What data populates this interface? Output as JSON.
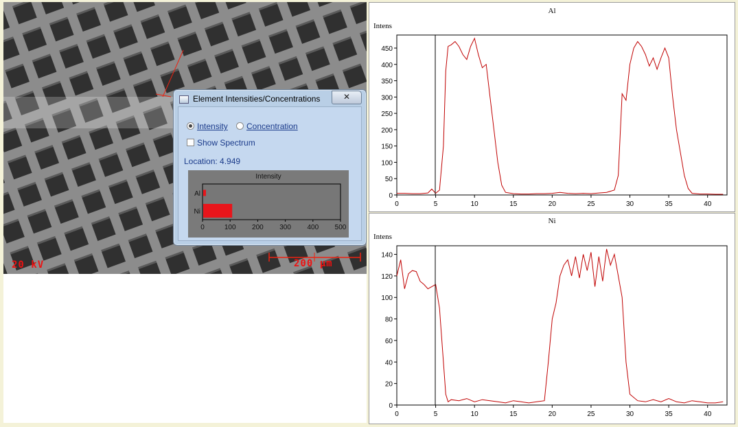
{
  "micrograph": {
    "kv_label": "20 kV",
    "scale_label": "200 µm"
  },
  "dialog": {
    "title": "Element Intensities/Concentrations",
    "close_glyph": "✕",
    "radio_intensity": "Intensity",
    "radio_concentration": "Concentration",
    "selected_mode": "Intensity",
    "show_spectrum_label": "Show Spectrum",
    "show_spectrum_checked": false,
    "location_text": "Location: 4.949",
    "bar_chart": {
      "title": "Intensity",
      "categories": [
        "Al",
        "Ni"
      ],
      "values": [
        10,
        105
      ],
      "xticks": [
        "0",
        "100",
        "200",
        "300",
        "400",
        "500"
      ],
      "xlim": [
        0,
        500
      ],
      "bar_color": "#e8151b"
    }
  },
  "chart_data": [
    {
      "type": "line",
      "title": "Al",
      "ylabel": "Intens",
      "xlim": [
        0,
        42.5
      ],
      "ylim": [
        0,
        490
      ],
      "xticks": [
        0,
        5,
        10,
        15,
        20,
        25,
        30,
        35,
        40
      ],
      "yticks": [
        0,
        50,
        100,
        150,
        200,
        250,
        300,
        350,
        400,
        450
      ],
      "marker_x": 4.949,
      "color": "#c00000",
      "x": [
        0,
        1,
        2,
        3,
        4,
        4.5,
        5,
        5.5,
        6,
        6.3,
        6.6,
        7,
        7.5,
        8,
        8.5,
        9,
        9.5,
        10,
        10.5,
        11,
        11.5,
        12,
        12.5,
        13,
        13.5,
        14,
        15,
        16,
        17,
        18,
        19,
        20,
        21,
        22,
        23,
        24,
        25,
        26,
        27,
        28,
        28.5,
        29,
        29.5,
        30,
        30.5,
        31,
        31.5,
        32,
        32.5,
        33,
        33.5,
        34,
        34.5,
        35,
        35.5,
        36,
        36.5,
        37,
        37.5,
        38,
        39,
        40,
        41,
        42
      ],
      "y": [
        5,
        5,
        4,
        4,
        6,
        18,
        5,
        15,
        150,
        380,
        455,
        460,
        470,
        455,
        430,
        415,
        455,
        480,
        430,
        390,
        400,
        300,
        200,
        100,
        30,
        8,
        4,
        3,
        3,
        4,
        4,
        5,
        8,
        5,
        4,
        5,
        4,
        6,
        8,
        15,
        60,
        310,
        290,
        400,
        450,
        470,
        455,
        430,
        395,
        420,
        385,
        420,
        450,
        420,
        300,
        200,
        130,
        60,
        20,
        5,
        3,
        3,
        2,
        2
      ]
    },
    {
      "type": "line",
      "title": "Ni",
      "ylabel": "Intens",
      "xlim": [
        0,
        42.5
      ],
      "ylim": [
        0,
        148
      ],
      "xticks": [
        0,
        5,
        10,
        15,
        20,
        25,
        30,
        35,
        40
      ],
      "yticks": [
        0,
        20,
        40,
        60,
        80,
        100,
        120,
        140
      ],
      "marker_x": 4.949,
      "color": "#c00000",
      "x": [
        0,
        0.5,
        1,
        1.5,
        2,
        2.5,
        3,
        3.5,
        4,
        4.5,
        5,
        5.5,
        6,
        6.3,
        6.6,
        7,
        8,
        9,
        10,
        11,
        12,
        13,
        14,
        15,
        16,
        17,
        18,
        19,
        19.5,
        20,
        20.5,
        21,
        21.5,
        22,
        22.5,
        23,
        23.5,
        24,
        24.5,
        25,
        25.5,
        26,
        26.5,
        27,
        27.5,
        28,
        28.5,
        29,
        29.5,
        30,
        31,
        32,
        33,
        34,
        35,
        36,
        37,
        38,
        39,
        40,
        41,
        42
      ],
      "y": [
        120,
        135,
        108,
        122,
        125,
        124,
        115,
        112,
        108,
        110,
        112,
        90,
        40,
        10,
        3,
        5,
        4,
        6,
        3,
        5,
        4,
        3,
        2,
        4,
        3,
        2,
        3,
        4,
        40,
        80,
        95,
        120,
        130,
        135,
        120,
        138,
        118,
        140,
        125,
        142,
        110,
        138,
        115,
        145,
        130,
        140,
        120,
        100,
        40,
        10,
        4,
        3,
        5,
        3,
        6,
        3,
        2,
        4,
        3,
        2,
        2,
        3
      ]
    }
  ]
}
